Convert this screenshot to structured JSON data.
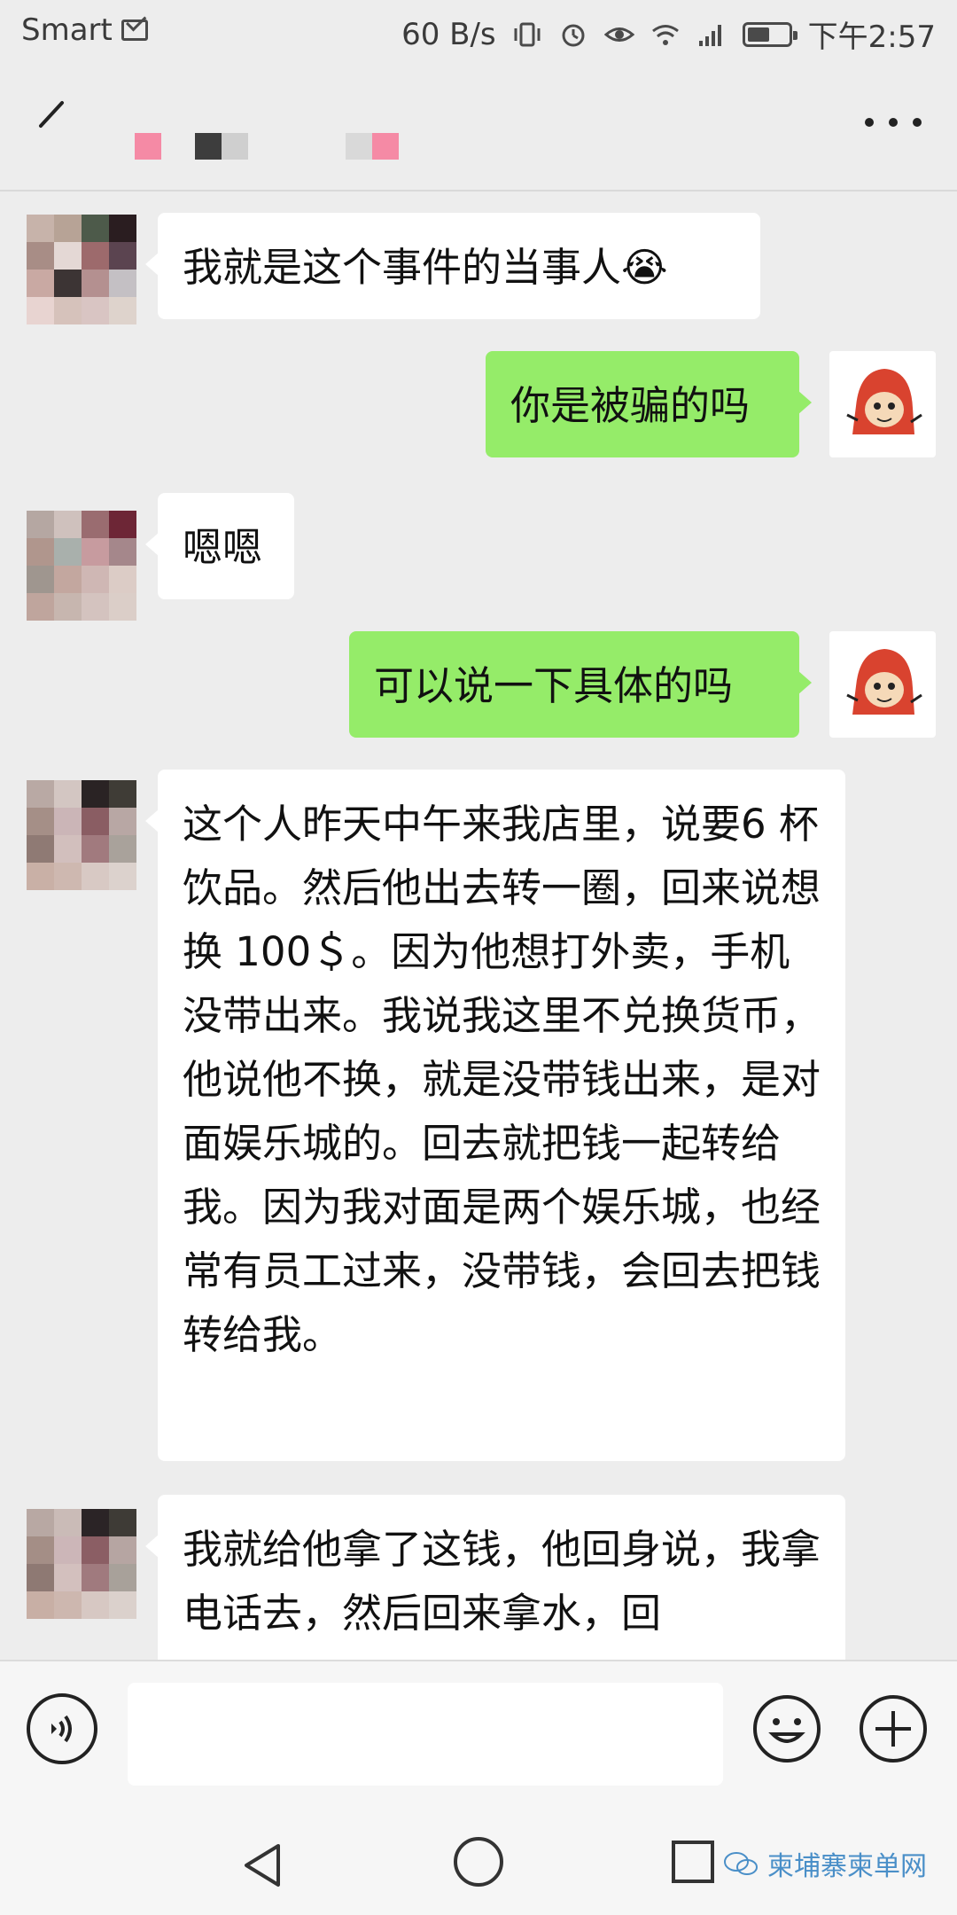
{
  "status_bar": {
    "carrier": "Smart",
    "net_speed": "60 B/s",
    "time": "下午2:57",
    "battery_level": 0.55,
    "icons": [
      "mail-icon",
      "vibrate-icon",
      "alarm-icon",
      "eye-icon",
      "wifi-icon",
      "signal-icon",
      "battery-icon"
    ]
  },
  "header": {
    "back_icon": "back-icon",
    "more_icon": "more-icon"
  },
  "messages": [
    {
      "side": "in",
      "text": "我就是这个事件的当事人😭"
    },
    {
      "side": "out",
      "text": "你是被骗的吗"
    },
    {
      "side": "in",
      "text": "嗯嗯"
    },
    {
      "side": "out",
      "text": "可以说一下具体的吗"
    },
    {
      "side": "in",
      "text": "这个人昨天中午来我店里，说要6 杯饮品。然后他出去转一圈，回来说想换 100＄。因为他想打外卖，手机没带出来。我说我这里不兑换货币，他说他不换，就是没带钱出来，是对面娱乐城的。回去就把钱一起转给我。因为我对面是两个娱乐城，也经常有员工过来，没带钱，会回去把钱转给我。"
    },
    {
      "side": "in",
      "text": "我就给他拿了这钱，他回身说，我拿电话去，然后回来拿水，回"
    }
  ],
  "input_bar": {
    "voice_icon": "voice-icon",
    "emoji_icon": "emoji-icon",
    "plus_icon": "plus-icon",
    "input_value": ""
  },
  "nav_bar": {
    "back_icon": "triangle-back-icon",
    "home_icon": "circle-home-icon",
    "recent_icon": "square-recent-icon",
    "watermark_text": "柬埔寨柬单网"
  },
  "colors": {
    "background": "#ededed",
    "bubble_out": "#95ec69",
    "bubble_in": "#ffffff",
    "watermark": "#4a8fc8"
  }
}
